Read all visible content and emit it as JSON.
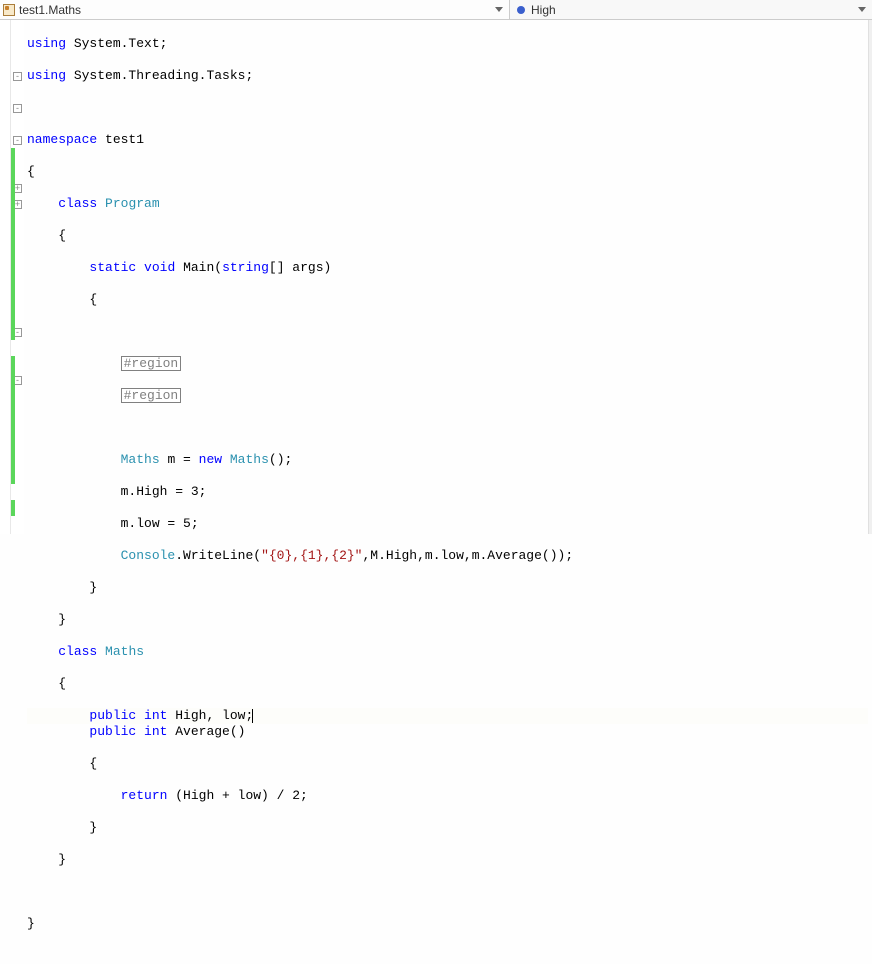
{
  "top": {
    "left": "test1.Maths",
    "right": "High"
  },
  "c": {
    "l1": "using",
    "l1b": " System.Text;",
    "l2": "using",
    "l2b": " System.Threading.Tasks;",
    "l4": "namespace",
    "l4b": " test1",
    "l5": "{",
    "l6a": "    ",
    "l6b": "class",
    "l6c": " ",
    "l6d": "Program",
    "l7": "    {",
    "l8a": "        ",
    "l8b": "static",
    "l8c": " ",
    "l8d": "void",
    "l8e": " Main(",
    "l8f": "string",
    "l8g": "[] args)",
    "l9": "        {",
    "l11a": "            ",
    "l11b": "#region",
    "l12a": "            ",
    "l12b": "#region",
    "l14a": "            ",
    "l14b": "Maths",
    "l14c": " m = ",
    "l14d": "new",
    "l14e": " ",
    "l14f": "Maths",
    "l14g": "();",
    "l15": "            m.High = 3;",
    "l16": "            m.low = 5;",
    "l17a": "            ",
    "l17b": "Console",
    "l17c": ".WriteLine(",
    "l17d": "\"{0},{1},{2}\"",
    "l17e": ",M.High,m.low,m.Average());",
    "l18": "        }",
    "l19": "    }",
    "l20a": "    ",
    "l20b": "class",
    "l20c": " ",
    "l20d": "Maths",
    "l21": "    {",
    "l22a": "        ",
    "l22b": "public",
    "l22c": " ",
    "l22d": "int",
    "l22e": " High, low;",
    "l23a": "        ",
    "l23b": "public",
    "l23c": " ",
    "l23d": "int",
    "l23e": " Average()",
    "l24": "        {",
    "l25a": "            ",
    "l25b": "return",
    "l25c": " (High + low) / 2;",
    "l26": "        }",
    "l27": "    }",
    "l29": "}"
  },
  "box": {
    "minus": "-",
    "plus": "+"
  }
}
